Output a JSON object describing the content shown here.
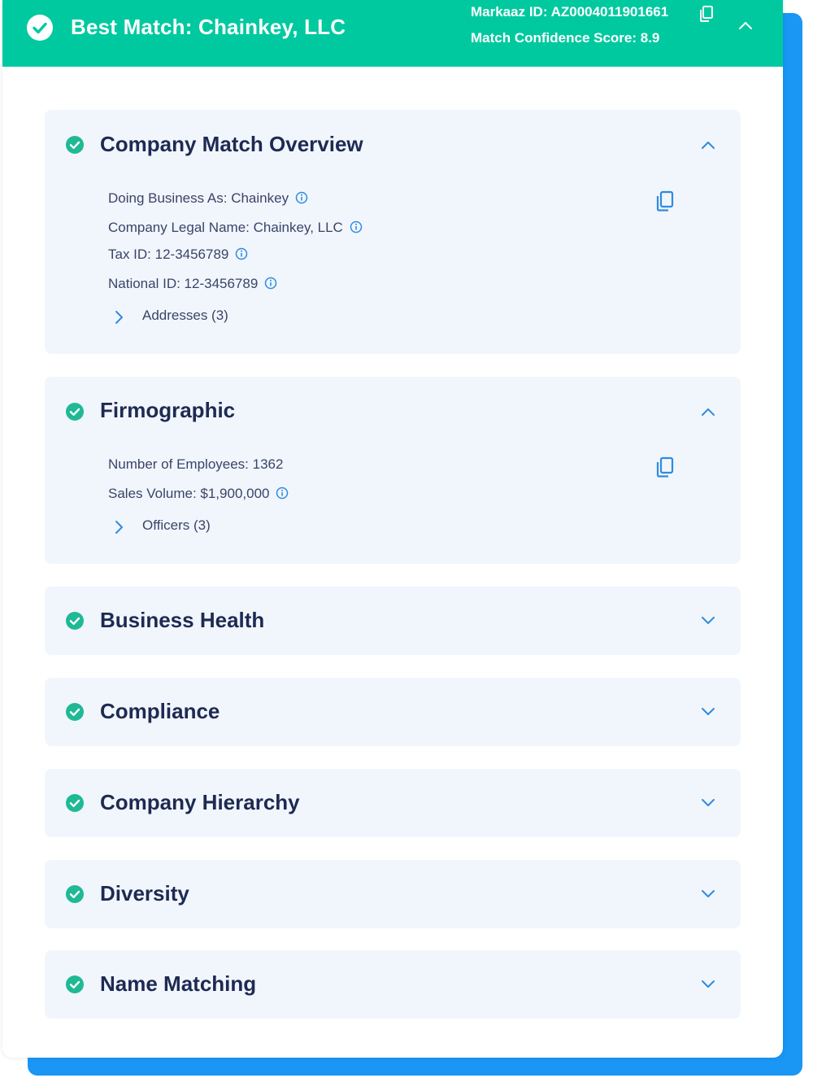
{
  "header": {
    "title": "Best Match: Chainkey, LLC",
    "markaaz_id": "Markaaz ID: AZ0004011901661",
    "confidence": "Match Confidence Score: 8.9"
  },
  "panels": {
    "overview": {
      "title": "Company Match Overview",
      "fields": [
        "Doing Business As: Chainkey",
        "Company Legal Name: Chainkey, LLC",
        "Tax ID: 12-3456789",
        "National ID: 12-3456789"
      ],
      "expand_label": "Addresses (3)"
    },
    "firmographic": {
      "title": "Firmographic",
      "fields": [
        "Number of Employees: 1362",
        "Sales Volume: $1,900,000"
      ],
      "expand_label": "Officers (3)"
    },
    "business_health": {
      "title": "Business Health"
    },
    "compliance": {
      "title": "Compliance"
    },
    "hierarchy": {
      "title": "Company Hierarchy"
    },
    "diversity": {
      "title": "Diversity"
    },
    "name_matching": {
      "title": "Name Matching"
    }
  },
  "icons": {
    "check": "check-circle-icon",
    "info": "info-icon",
    "copy": "copy-icon",
    "chevron_up": "chevron-up-icon",
    "chevron_down": "chevron-down-icon",
    "chevron_right": "chevron-right-icon"
  },
  "colors": {
    "header_bg": "#00c9a0",
    "accent_blue": "#1a96f5",
    "panel_bg": "#f1f6fc",
    "title_text": "#1e2a52",
    "check_green": "#1fb996",
    "icon_blue": "#2f8be0"
  }
}
